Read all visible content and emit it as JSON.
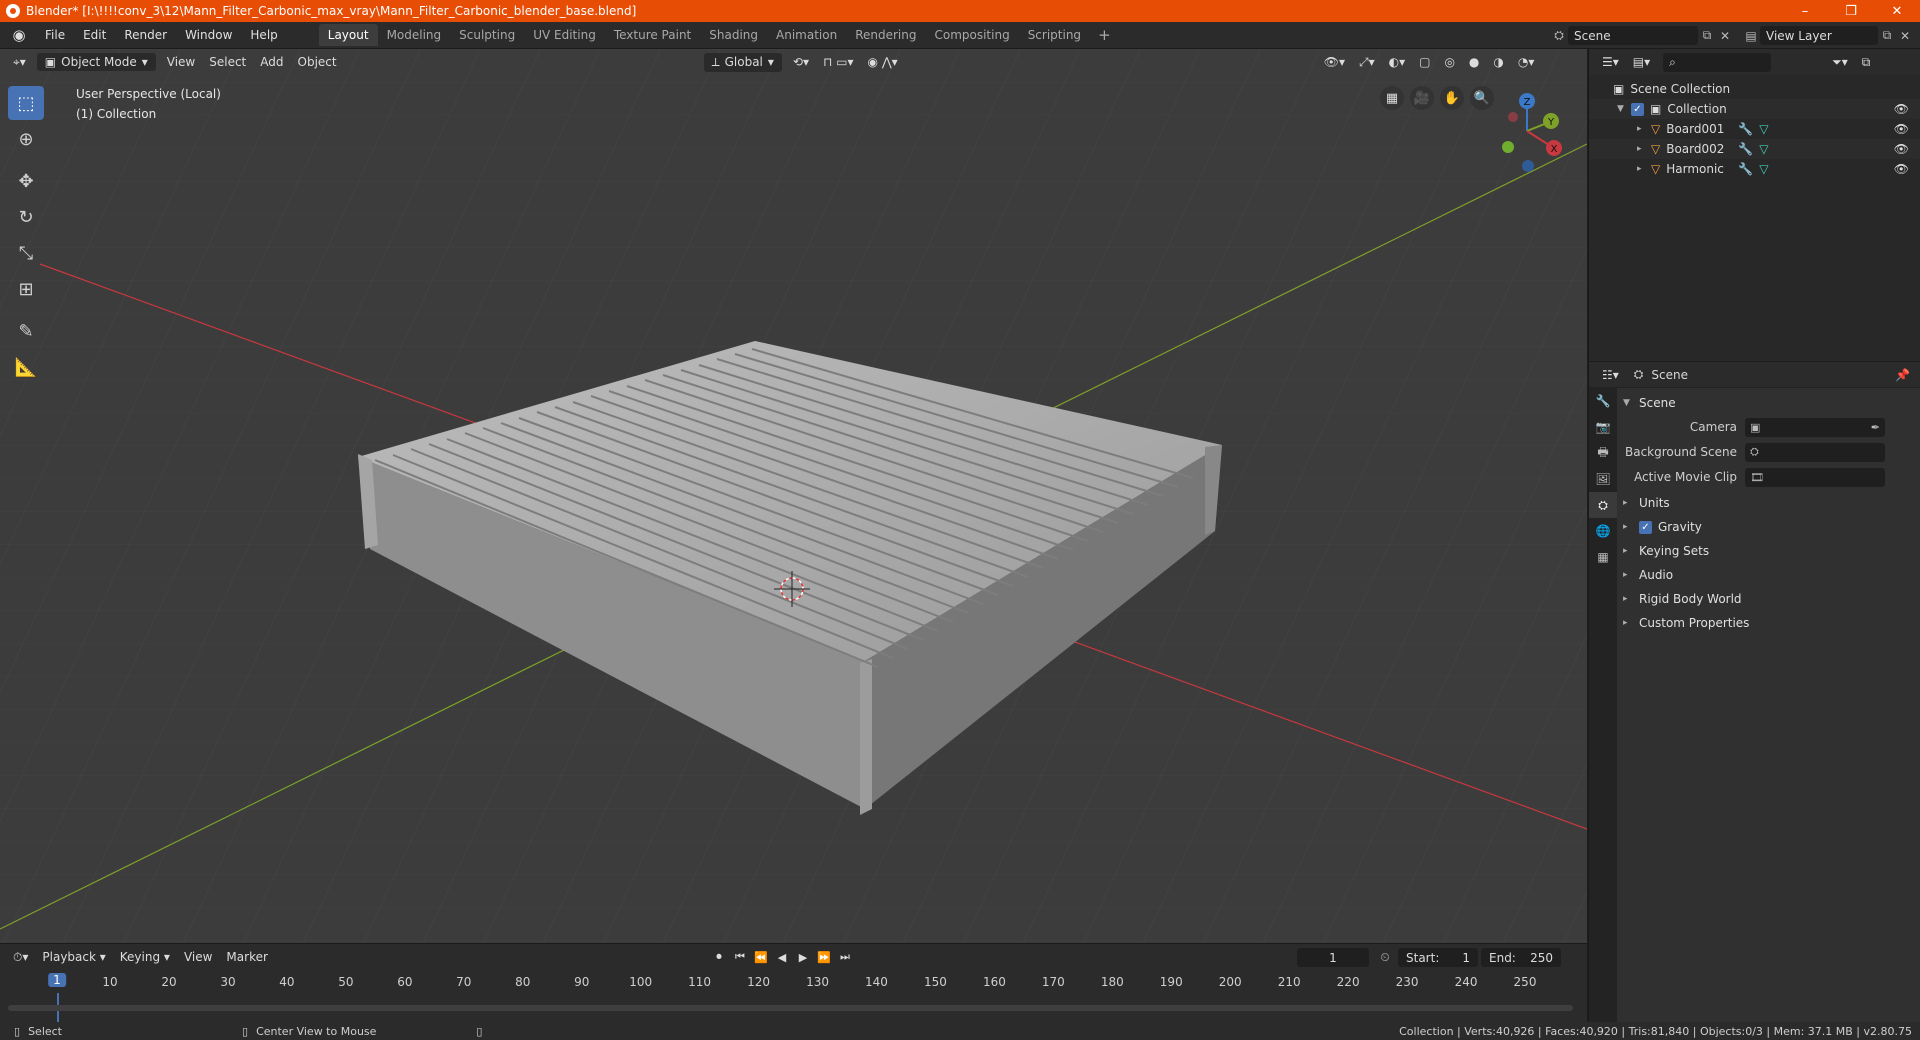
{
  "window": {
    "title": "Blender* [I:\\!!!!conv_3\\12\\Mann_Filter_Carbonic_max_vray\\Mann_Filter_Carbonic_blender_base.blend]",
    "minimize": "–",
    "maximize": "❐",
    "close": "✕"
  },
  "menus": [
    "File",
    "Edit",
    "Render",
    "Window",
    "Help"
  ],
  "workspaces": [
    "Layout",
    "Modeling",
    "Sculpting",
    "UV Editing",
    "Texture Paint",
    "Shading",
    "Animation",
    "Rendering",
    "Compositing",
    "Scripting"
  ],
  "workspace_add": "+",
  "scene_selector": "Scene",
  "view_layer": "View Layer",
  "viewport": {
    "mode": "Object Mode",
    "menus": [
      "View",
      "Select",
      "Add",
      "Object"
    ],
    "orientation": "Global",
    "perspective_label": "User Perspective (Local)",
    "collection_label": "(1) Collection",
    "gizmo": {
      "x": "X",
      "y": "Y",
      "z": "Z"
    }
  },
  "timeline": {
    "menus": [
      "Playback",
      "Keying",
      "View",
      "Marker"
    ],
    "current_frame": "1",
    "start_label": "Start:",
    "start": "1",
    "end_label": "End:",
    "end": "250",
    "ruler": [
      "1",
      "10",
      "20",
      "30",
      "40",
      "50",
      "60",
      "70",
      "80",
      "90",
      "100",
      "110",
      "120",
      "130",
      "140",
      "150",
      "160",
      "170",
      "180",
      "190",
      "200",
      "210",
      "220",
      "230",
      "240",
      "250"
    ]
  },
  "statusbar": {
    "select": "Select",
    "center_view": "Center View to Mouse",
    "stats": "Collection | Verts:40,926 | Faces:40,920 | Tris:81,840 | Objects:0/3 | Mem: 37.1 MB | v2.80.75"
  },
  "outliner": {
    "scene_collection": "Scene Collection",
    "collection": "Collection",
    "objects": [
      "Board001",
      "Board002",
      "Harmonic"
    ]
  },
  "properties": {
    "header": "Scene",
    "panel": "Scene",
    "camera_label": "Camera",
    "background_scene_label": "Background Scene",
    "active_movie_clip_label": "Active Movie Clip",
    "sections": [
      "Units",
      "Gravity",
      "Keying Sets",
      "Audio",
      "Rigid Body World",
      "Custom Properties"
    ]
  },
  "colors": {
    "titlebar": "#e84d06",
    "accent": "#4772b3",
    "x_axis": "#c8383f",
    "y_axis": "#7ea12a",
    "z_axis": "#3b78c8"
  }
}
